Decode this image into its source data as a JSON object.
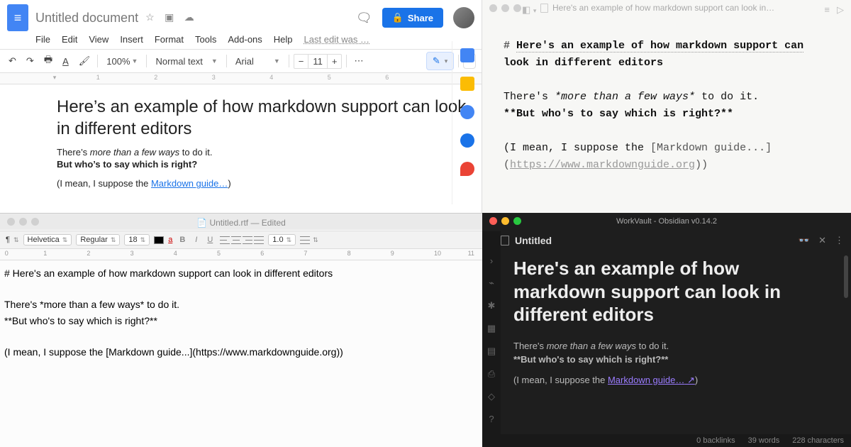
{
  "gdocs": {
    "doc_title": "Untitled document",
    "menus": [
      "File",
      "Edit",
      "View",
      "Insert",
      "Format",
      "Tools",
      "Add-ons",
      "Help"
    ],
    "edit_time": "Last edit was …",
    "zoom": "100%",
    "paragraph_style": "Normal text",
    "font": "Arial",
    "font_size": "11",
    "share_label": "Share",
    "heading": "Here’s an example of how markdown support can look in different editors",
    "line1_pre": "There’s ",
    "line1_em": "more than a few ways",
    "line1_post": " to do it.",
    "line2": "But who’s to say which is right?",
    "line3_pre": "(I mean, I suppose the ",
    "line3_link": "Markdown guide…",
    "line3_post": ")",
    "ruler": [
      "1",
      "2",
      "3",
      "4",
      "5",
      "6"
    ]
  },
  "iaw": {
    "tab_title": "Here's an example of how markdown support can look in…",
    "h_prefix": "# ",
    "heading_l1": "Here's an example of how markdown support can",
    "heading_l2": "look in different editors",
    "line1_pre": "There's ",
    "line1_em": "*more than a few ways*",
    "line1_post": " to do it.",
    "line2": "**But who's to say which is right?**",
    "line3_pre": "(I mean, I suppose the ",
    "line3_linktext": "[Markdown guide...]",
    "line4_pre": "(",
    "line4_url": "https://www.markdownguide.org",
    "line4_post": "))"
  },
  "textedit": {
    "window_title": "Untitled.rtf — Edited",
    "font_family": "Helvetica",
    "font_style": "Regular",
    "font_size": "18",
    "line_spacing": "1.0",
    "ruler": [
      "0",
      "1",
      "2",
      "3",
      "4",
      "5",
      "6",
      "7",
      "8",
      "9",
      "10",
      "11"
    ],
    "l1": "# Here's an example of how markdown support can look in different editors",
    "l2": "There's *more than a few ways* to do it.",
    "l3": "**But who's to say which is right?**",
    "l4": "(I mean, I suppose the [Markdown guide...](https://www.markdownguide.org))"
  },
  "obsidian": {
    "window_title": "WorkVault - Obsidian v0.14.2",
    "tab_title": "Untitled",
    "heading": "Here's an example of how markdown support can look in different editors",
    "line1_pre": "There's ",
    "line1_em": "more than a few ways",
    "line1_post": " to do it.",
    "line2": "**But who's to say which is right?**",
    "line3_pre": "(I mean, I suppose the ",
    "line3_link": "Markdown guide…",
    "line3_ext": " ↗",
    "line3_post": ")",
    "status_backlinks": "0 backlinks",
    "status_words": "39 words",
    "status_chars": "228 characters"
  }
}
